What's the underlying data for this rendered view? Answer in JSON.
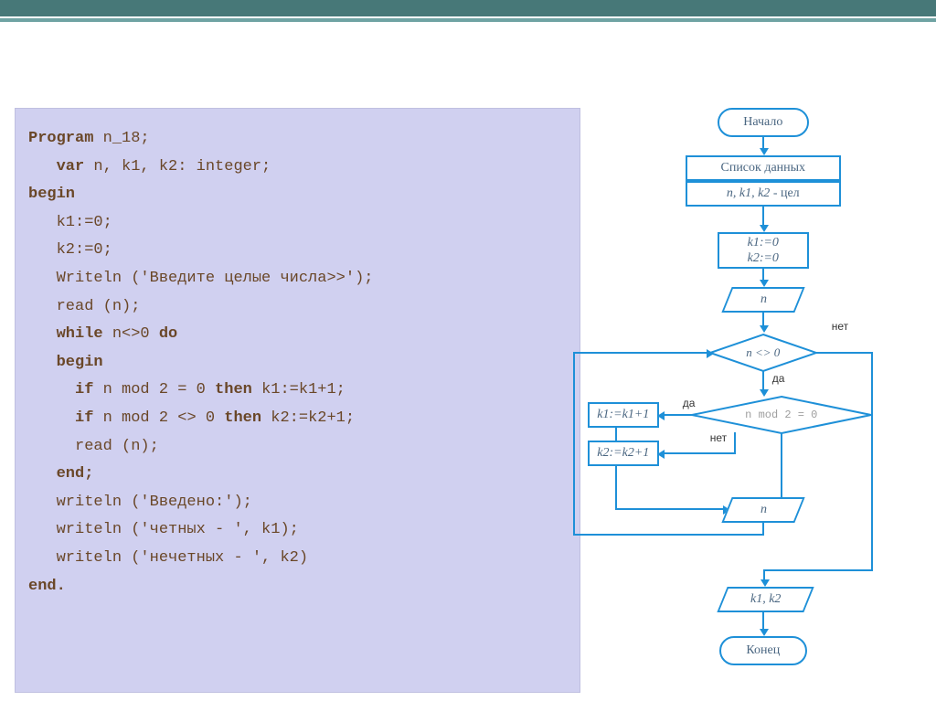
{
  "code": {
    "l1a": "Program ",
    "l1b": "n_18;",
    "l2a": "var ",
    "l2b": "n, k1, k2: integer;",
    "l3": "begin",
    "l4": "k1:=0;",
    "l5": "k2:=0;",
    "l6": "Writeln ('Введите целые числа>>');",
    "l7": "read (n);",
    "l8a": "while ",
    "l8b": "n<>0 ",
    "l8c": "do",
    "l9": "begin",
    "l10a": "if ",
    "l10b": "n mod 2 = 0 ",
    "l10c": "then ",
    "l10d": "k1:=k1+1;",
    "l11a": "if ",
    "l11b": "n mod 2 <> 0 ",
    "l11c": "then ",
    "l11d": "k2:=k2+1;",
    "l12": "read (n);",
    "l13": "end;",
    "l14": "writeln ('Введено:');",
    "l15": "writeln ('четных - ', k1);",
    "l16": "writeln ('нечетных - ', k2)",
    "l17": "end."
  },
  "flow": {
    "start": "Начало",
    "data_list": "Список данных",
    "vars": "n, k1, k2 - цел",
    "init1": "k1:=0",
    "init2": "k2:=0",
    "input_n": "n",
    "cond1": "n <> 0",
    "cond2": "n mod 2 = 0",
    "assign1": "k1:=k1+1",
    "assign2": "k2:=k2+1",
    "input_n2": "n",
    "output": "k1, k2",
    "end": "Конец",
    "yes": "да",
    "no": "нет"
  }
}
